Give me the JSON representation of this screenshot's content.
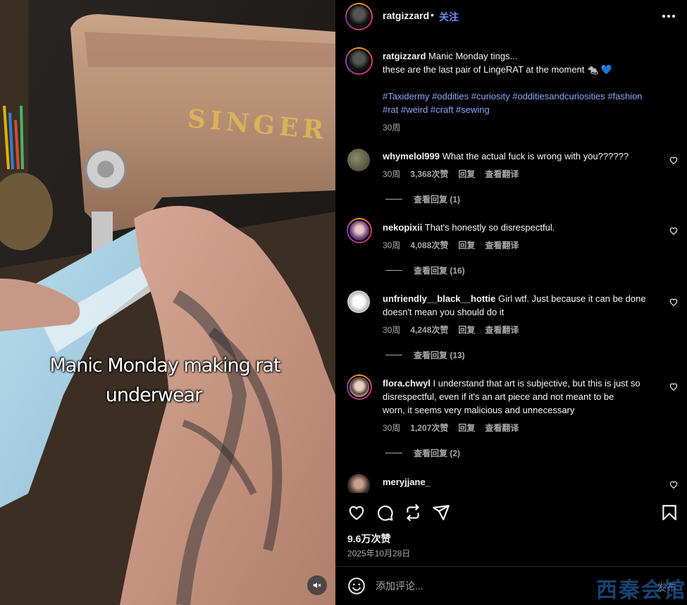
{
  "video": {
    "caption_line1": "Manic Monday making rat",
    "caption_line2": "underwear",
    "machine_brand": "SINGER",
    "mute_icon": "speaker-muted-icon"
  },
  "header": {
    "username": "ratgizzard",
    "dot": "•",
    "follow_label": "关注",
    "more_icon": "more-horizontal-icon"
  },
  "post": {
    "username": "ratgizzard",
    "caption_line1": "Manic Monday tings...",
    "caption_line2": "these are the last pair of LingeRAT at the moment 🐀 💙",
    "hashtags_line1": "#Taxidermy #oddities #curiosity #odditiesandcuriosities #fashion",
    "hashtags_line2": "#rat #weird #craft #sewing",
    "time": "30周"
  },
  "comments": [
    {
      "username": "whymelol999",
      "text": "What the actual fuck is wrong with you??????",
      "time": "30周",
      "likes": "3,368次赞",
      "reply": "回复",
      "translate": "查看翻译",
      "replies": "查看回复 (1)"
    },
    {
      "username": "nekopixii",
      "text": "That's honestly so disrespectful.",
      "time": "30周",
      "likes": "4,088次赞",
      "reply": "回复",
      "translate": "查看翻译",
      "replies": "查看回复 (16)"
    },
    {
      "username": "unfriendly__black__hottie",
      "text": "Girl wtf. Just because it can be done",
      "text2": "doesn't mean you should do it",
      "time": "30周",
      "likes": "4,248次赞",
      "reply": "回复",
      "translate": "查看翻译",
      "replies": "查看回复 (13)"
    },
    {
      "username": "flora.chwyl",
      "text": "I understand that art is subjective, but this is just so",
      "text2": "disrespectful, even if it's an art piece and not meant to be",
      "text3": "worn, it seems very malicious and unnecessary",
      "time": "30周",
      "likes": "1,207次赞",
      "reply": "回复",
      "translate": "查看翻译",
      "replies": "查看回复 (2)"
    },
    {
      "username": "meryjjane_"
    }
  ],
  "actions": {
    "like_icon": "heart-icon",
    "comment_icon": "comment-icon",
    "share_icon": "repost-icon",
    "send_icon": "send-icon",
    "save_icon": "bookmark-icon"
  },
  "stats": {
    "likes": "9.6万次赞",
    "date": "2025年10月28日"
  },
  "composer": {
    "placeholder": "添加评论...",
    "post_label": "发布",
    "emoji_icon": "smiley-icon"
  },
  "watermark": "西秦会馆",
  "colors": {
    "link": "#6b8cff",
    "hashtag": "#8ea7ff",
    "muted": "#a8a8a8",
    "background": "#000000"
  }
}
